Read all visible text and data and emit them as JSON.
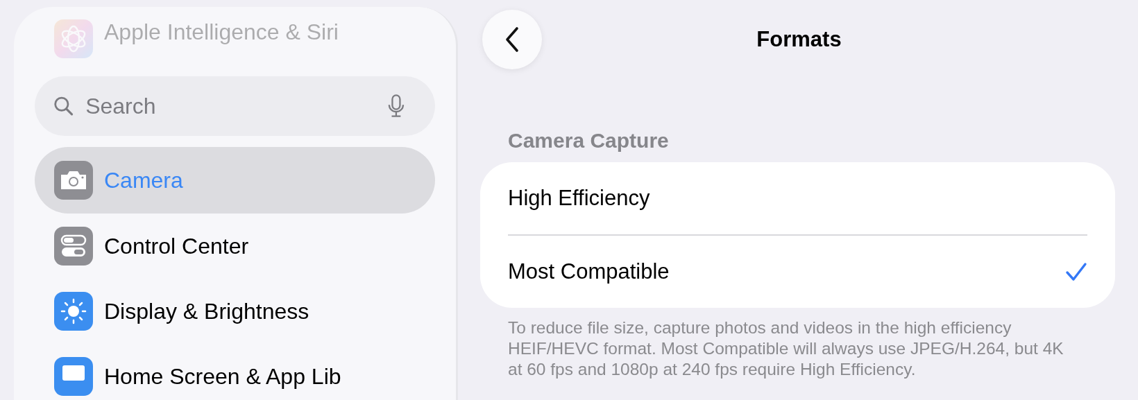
{
  "sidebar": {
    "items": [
      {
        "label": "Apple Intelligence & Siri",
        "kind": "intelligence",
        "selected": false,
        "faded": true
      },
      {
        "label": "Camera",
        "kind": "camera",
        "selected": true,
        "faded": false
      },
      {
        "label": "Control Center",
        "kind": "toggles",
        "selected": false,
        "faded": false
      },
      {
        "label": "Display & Brightness",
        "kind": "sun",
        "selected": false,
        "faded": false
      },
      {
        "label": "Home Screen & App Lib",
        "kind": "grid",
        "selected": false,
        "faded": false
      }
    ],
    "search": {
      "placeholder": "Search"
    }
  },
  "header": {
    "title": "Formats"
  },
  "section": {
    "title": "Camera Capture",
    "options": [
      {
        "label": "High Efficiency",
        "selected": false
      },
      {
        "label": "Most Compatible",
        "selected": true
      }
    ],
    "footer": "To reduce file size, capture photos and videos in the high efficiency HEIF/HEVC format. Most Compatible will always use JPEG/H.264, but 4K at 60 fps and 1080p at 240 fps require High Efficiency."
  }
}
